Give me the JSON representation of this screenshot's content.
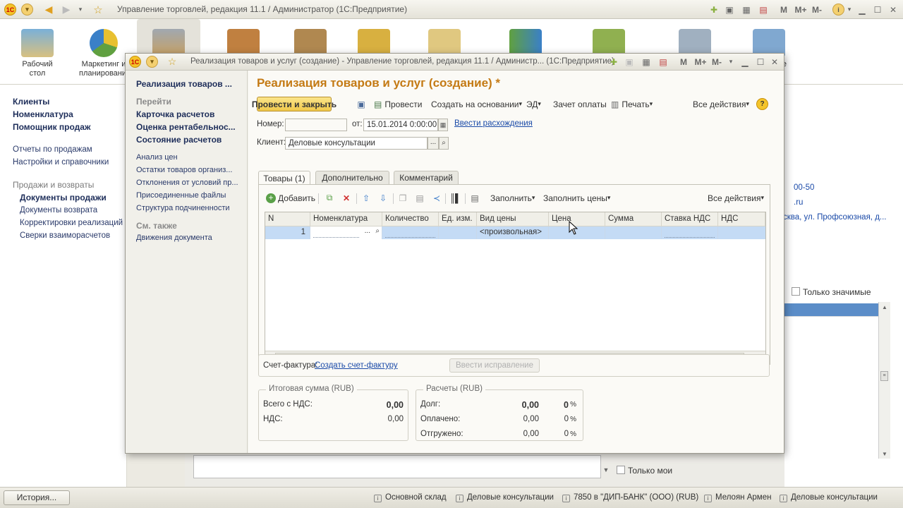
{
  "main_window": {
    "title": "Управление торговлей, редакция 11.1 / Администратор  (1С:Предприятие)",
    "title_buttons": [
      "M",
      "M+",
      "M-"
    ],
    "sections": [
      "Рабочий стол",
      "Маркетинг и планирование"
    ],
    "section_partial": "вание"
  },
  "left_panel": {
    "top_links": [
      "Клиенты",
      "Номенклатура",
      "Помощник продаж"
    ],
    "mid_links": [
      "Отчеты по продажам",
      "Настройки и справочники"
    ],
    "group_header": "Продажи и возвраты",
    "group_items": [
      "Документы продажи",
      "Документы возврата",
      "Корректировки реализаций",
      "Сверки взаиморасчетов"
    ]
  },
  "background_right": {
    "fragment_1": "00-50",
    "fragment_2": ".ru",
    "fragment_3": "сква, ул. Профсоюзная, д...",
    "checkbox_significant": "Только значимые",
    "checkbox_mine": "Только мои"
  },
  "modal": {
    "title": "Реализация товаров и услуг (создание) - Управление торговлей, редакция 11.1 / Администр...  (1С:Предприятие)",
    "title_buttons": [
      "M",
      "M+",
      "M-"
    ],
    "nav": {
      "current": "Реализация товаров ...",
      "goto_header": "Перейти",
      "goto_bold": [
        "Карточка расчетов",
        "Оценка рентабельнос...",
        "Состояние расчетов"
      ],
      "goto_links": [
        "Анализ цен",
        "Остатки товаров организ...",
        "Отклонения от условий пр...",
        "Присоединенные файлы",
        "Структура подчиненности"
      ],
      "see_also_header": "См. также",
      "see_also_links": [
        "Движения документа"
      ]
    },
    "heading": "Реализация товаров и услуг (создание) *",
    "toolbar": {
      "post_close": "Провести и закрыть",
      "post": "Провести",
      "create_based": "Создать на основании",
      "ed": "ЭД",
      "payment_offset": "Зачет оплаты",
      "print": "Печать",
      "all_actions": "Все действия",
      "help": "?"
    },
    "number_label": "Номер:",
    "number_value": "",
    "date_label": "от:",
    "date_value": "15.01.2014  0:00:00",
    "discrepancy_link": "Ввести расхождения",
    "client_label": "Клиент:",
    "client_value": "Деловые консультации",
    "tabs": [
      "Товары (1)",
      "Дополнительно",
      "Комментарий"
    ],
    "table_toolbar": {
      "add": "Добавить",
      "fill": "Заполнить",
      "fill_prices": "Заполнить цены",
      "all_actions": "Все действия"
    },
    "table": {
      "columns": [
        "N",
        "Номенклатура",
        "Количество",
        "Ед. изм.",
        "Вид цены",
        "Цена",
        "Сумма",
        "Ставка НДС",
        "НДС"
      ],
      "rows": [
        {
          "n": "1",
          "nomenclature": "",
          "quantity": "",
          "unit": "",
          "price_type": "<произвольная>",
          "price": "",
          "sum": "",
          "vat_rate": "",
          "vat": ""
        }
      ]
    },
    "invoice_label": "Счет-фактура:",
    "invoice_link": "Создать счет-фактуру",
    "correction_button": "Ввести исправление",
    "totals": {
      "title": "Итоговая сумма (RUB)",
      "total_with_vat_label": "Всего с НДС:",
      "total_with_vat": "0,00",
      "vat_label": "НДС:",
      "vat": "0,00"
    },
    "settlements": {
      "title": "Расчеты (RUB)",
      "rows": [
        {
          "label": "Долг:",
          "value": "0,00",
          "percent": "0",
          "unit": "%"
        },
        {
          "label": "Оплачено:",
          "value": "0,00",
          "percent": "0",
          "unit": "%"
        },
        {
          "label": "Отгружено:",
          "value": "0,00",
          "percent": "0",
          "unit": "%"
        }
      ]
    }
  },
  "status_bar": {
    "history": "История...",
    "items": [
      "Основной склад",
      "Деловые консультации",
      "7850 в \"ДИП-БАНК\" (ООО) (RUB)",
      "Мелоян Армен",
      "Деловые консультации"
    ]
  }
}
